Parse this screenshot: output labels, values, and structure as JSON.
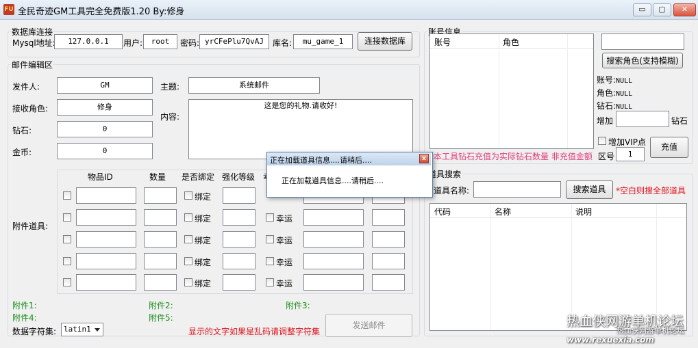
{
  "window": {
    "title": "全民奇迹GM工具完全免费版1.20  By:修身",
    "app_icon_text": "FU",
    "minimize": "▭",
    "maximize": "▢",
    "close": "✕"
  },
  "db": {
    "legend": "数据库连接",
    "host_label": "Mysql地址:",
    "host": "127.0.0.1",
    "user_label": "用户:",
    "user": "root",
    "pass_label": "密码:",
    "pass": "yrCFePlu7QvAJ",
    "db_label": "库名:",
    "db_name": "mu_game_1",
    "connect_button": "连接数据库"
  },
  "mail": {
    "legend": "邮件编辑区",
    "sender_label": "发件人:",
    "sender": "GM",
    "receiver_label": "接收角色:",
    "receiver": "修身",
    "diamond_label": "钻石:",
    "diamond": "0",
    "gold_label": "金币:",
    "gold": "0",
    "subject_label": "主题:",
    "subject": "系统邮件",
    "content_label": "内容:",
    "content": "这是您的礼物.请收好!",
    "attach_label": "附件道具:",
    "headers": [
      "物品ID",
      "数量",
      "是否绑定",
      "强化等级",
      "幸"
    ],
    "bind_label": "绑定",
    "lucky_label": "幸运",
    "attach1": "附件1:",
    "attach2": "附件2:",
    "attach3": "附件3:",
    "attach4": "附件4:",
    "attach5": "附件5:",
    "charset_label": "数据字符集:",
    "charset": "latin1",
    "charset_hint": "显示的文字如果是乱码请调整字符集",
    "send_button": "发送邮件"
  },
  "account": {
    "legend": "账号信息",
    "col_account": "账号",
    "col_role": "角色",
    "search_button": "搜索角色(支持模糊)",
    "account_label": "账号:",
    "account_value": "NULL",
    "role_label": "角色:",
    "role_value": "NULL",
    "diamond_label": "钻石:",
    "diamond_value": "NULL",
    "add_label": "增加",
    "add_unit": "钻石",
    "vip_label": "增加VIP点",
    "zone_label": "区号",
    "zone_value": "1",
    "recharge_button": "充值",
    "notice": "*本工具钻石充值为实际钻石数量 非充值金额"
  },
  "item": {
    "legend": "道具搜索",
    "name_label": "道具名称:",
    "search_button": "搜索道具",
    "hint": "*空白则搜全部道具",
    "col_code": "代码",
    "col_name": "名称",
    "col_desc": "说明"
  },
  "dialog": {
    "title": "正在加载道具信息....请稍后....",
    "message": "正在加载道具信息....请稍后....",
    "close": "x"
  },
  "watermark": {
    "big": "热血侠网游单机论坛",
    "small": "热血侠网游单机论坛",
    "url": "www.rexuexia.com"
  }
}
